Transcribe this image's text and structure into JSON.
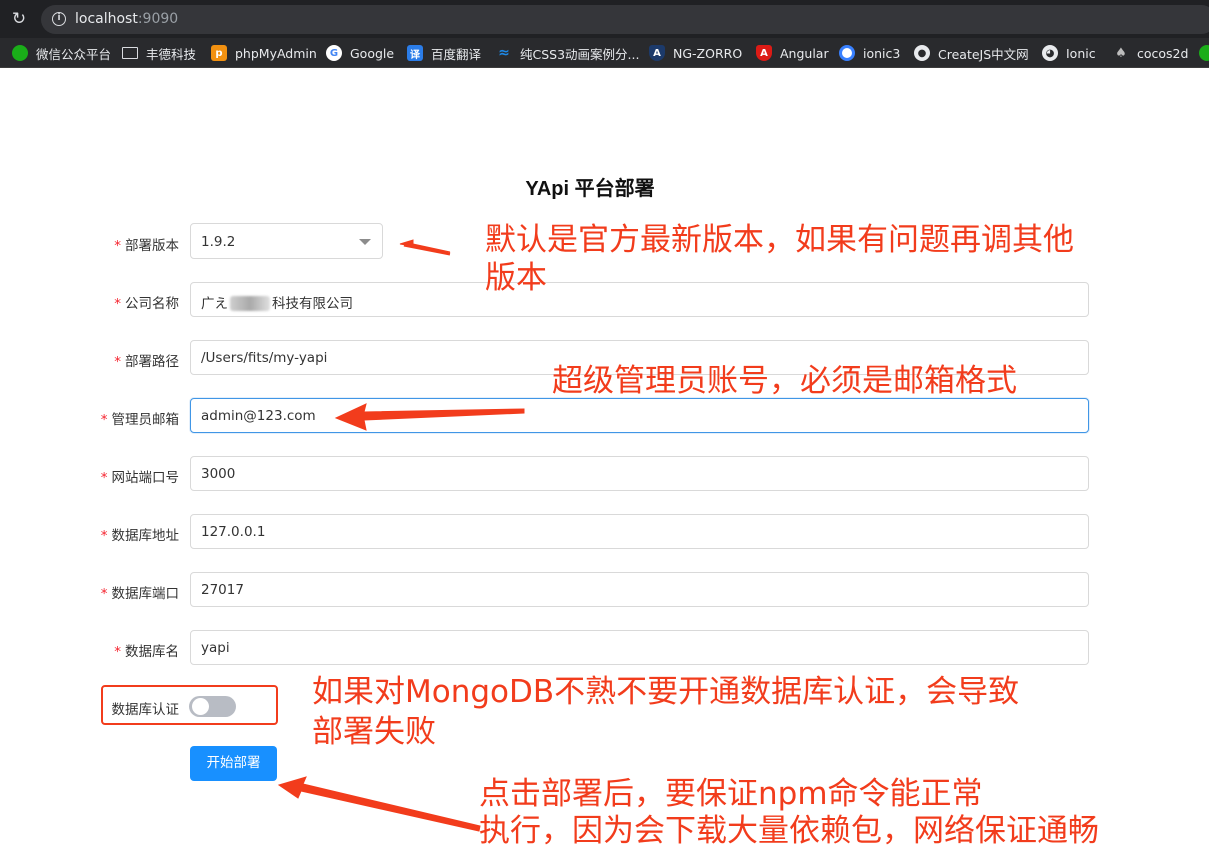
{
  "browser": {
    "url_host": "localhost",
    "url_port": ":9090",
    "bookmarks": [
      {
        "label": "微信公众平台",
        "icon": "wechat-icon",
        "color": "#1aad19"
      },
      {
        "label": "丰德科技",
        "icon": "folder-icon",
        "color": "#9aa0a6"
      },
      {
        "label": "phpMyAdmin",
        "icon": "phpmyadmin-icon",
        "color": "#f29111"
      },
      {
        "label": "Google",
        "icon": "google-icon",
        "color": "#4285f4"
      },
      {
        "label": "百度翻译",
        "icon": "baidu-translate-icon",
        "color": "#2b7de9"
      },
      {
        "label": "纯CSS3动画案例分...",
        "icon": "css3-icon",
        "color": "#1e88e5"
      },
      {
        "label": "NG-ZORRO",
        "icon": "ng-zorro-icon",
        "color": "#1c3a6b"
      },
      {
        "label": "Angular",
        "icon": "angular-icon",
        "color": "#dd1b16"
      },
      {
        "label": "ionic3",
        "icon": "ionic-icon",
        "color": "#3880ff"
      },
      {
        "label": "CreateJS中文网",
        "icon": "globe-icon",
        "color": "#e8eaed"
      },
      {
        "label": "Ionic",
        "icon": "github-icon",
        "color": "#e8eaed"
      },
      {
        "label": "cocos2d",
        "icon": "cocos-icon",
        "color": "#9aa0a6"
      },
      {
        "label": "",
        "icon": "wechat-icon",
        "color": "#1aad19"
      }
    ]
  },
  "form": {
    "title": "YApi 平台部署",
    "version": {
      "label": "部署版本",
      "value": "1.9.2"
    },
    "company": {
      "label": "公司名称",
      "value_prefix": "广え",
      "value_suffix": "科技有限公司"
    },
    "path": {
      "label": "部署路径",
      "value": "/Users/fits/my-yapi"
    },
    "admin_email": {
      "label": "管理员邮箱",
      "value": "admin@123.com"
    },
    "port": {
      "label": "网站端口号",
      "value": "3000"
    },
    "db_address": {
      "label": "数据库地址",
      "value": "127.0.0.1"
    },
    "db_port": {
      "label": "数据库端口",
      "value": "27017"
    },
    "db_name": {
      "label": "数据库名",
      "value": "yapi"
    },
    "db_auth": {
      "label": "数据库认证",
      "enabled": false
    },
    "submit_label": "开始部署"
  },
  "annotations": {
    "version_note": [
      "默认是官方最新版本，如果有问题再调其他",
      "版本"
    ],
    "admin_note": "超级管理员账号，必须是邮箱格式",
    "auth_note": [
      "如果对MongoDB不熟不要开通数据库认证，会导致",
      "部署失败"
    ],
    "deploy_note": [
      "点击部署后，要保证npm命令能正常",
      "执行，因为会下载大量依赖包，网络保证通畅"
    ],
    "color": "#f23c1c"
  }
}
